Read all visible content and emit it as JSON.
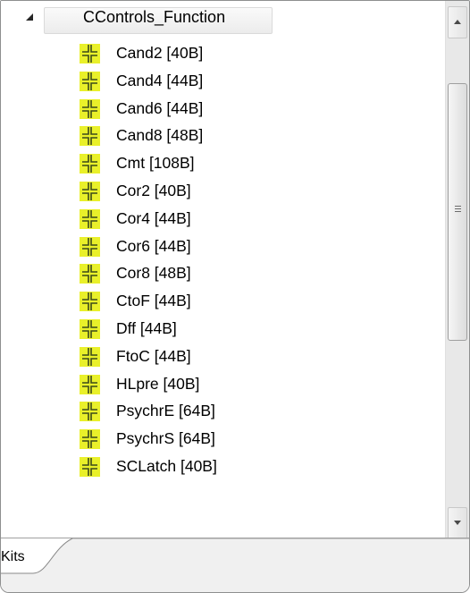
{
  "tree": {
    "root": {
      "label": "CControls_Function",
      "expanded": true
    },
    "items": [
      {
        "label": "Cand2 [40B]",
        "icon": "component-icon"
      },
      {
        "label": "Cand4 [44B]",
        "icon": "component-icon"
      },
      {
        "label": "Cand6 [44B]",
        "icon": "component-icon"
      },
      {
        "label": "Cand8 [48B]",
        "icon": "component-icon"
      },
      {
        "label": "Cmt [108B]",
        "icon": "component-icon"
      },
      {
        "label": "Cor2 [40B]",
        "icon": "component-icon"
      },
      {
        "label": "Cor4 [44B]",
        "icon": "component-icon"
      },
      {
        "label": "Cor6 [44B]",
        "icon": "component-icon"
      },
      {
        "label": "Cor8 [48B]",
        "icon": "component-icon"
      },
      {
        "label": "CtoF [44B]",
        "icon": "component-icon"
      },
      {
        "label": "Dff [44B]",
        "icon": "component-icon"
      },
      {
        "label": "FtoC [44B]",
        "icon": "component-icon"
      },
      {
        "label": "HLpre [40B]",
        "icon": "component-icon"
      },
      {
        "label": "PsychrE [64B]",
        "icon": "component-icon"
      },
      {
        "label": "PsychrS [64B]",
        "icon": "component-icon"
      },
      {
        "label": "SCLatch [40B]",
        "icon": "component-icon"
      }
    ]
  },
  "tabs": [
    {
      "label": "Kits",
      "active": true
    }
  ],
  "colors": {
    "icon_background": "#e9f02a",
    "icon_foreground": "#3c4a1a"
  }
}
